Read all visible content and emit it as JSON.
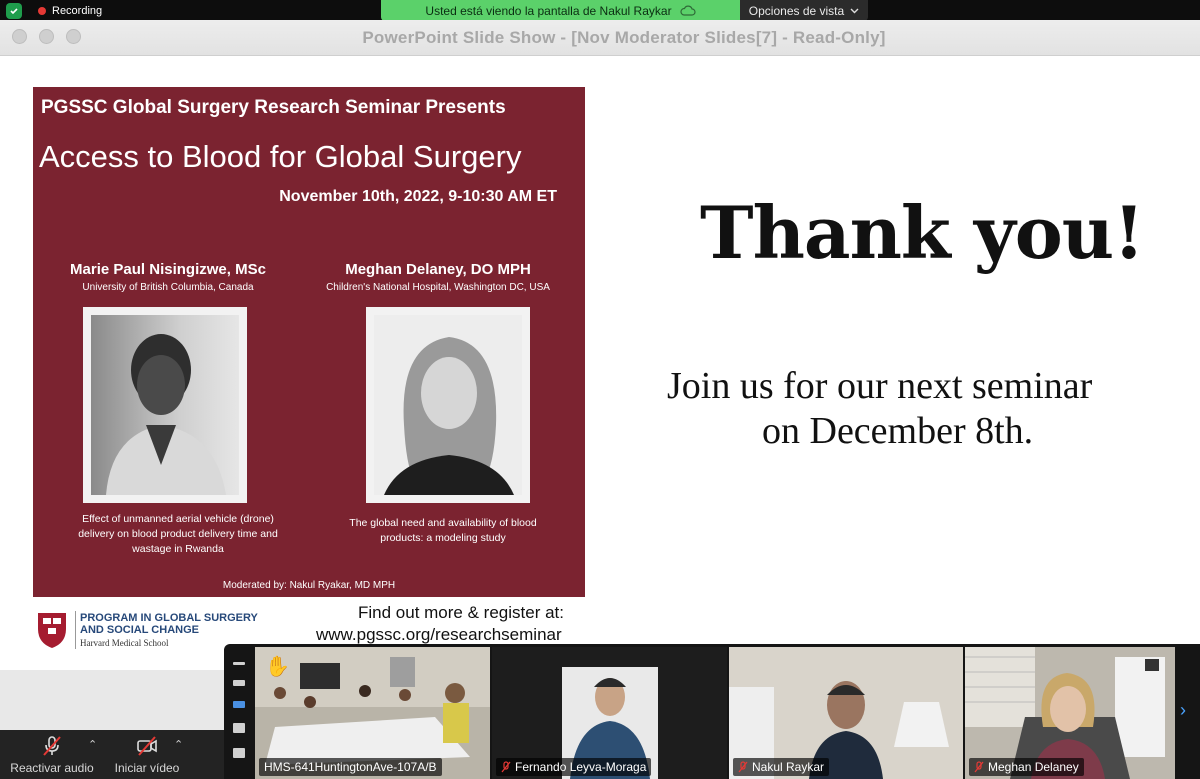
{
  "zoom_top": {
    "recording_label": "Recording",
    "sharing_banner": "Usted está viendo la pantalla de Nakul Raykar",
    "view_options_label": "Opciones de vista"
  },
  "ppt": {
    "window_title": "PowerPoint Slide Show - [Nov Moderator Slides[7]  -  Read-Only]"
  },
  "slide": {
    "flyer": {
      "heading": "PGSSC Global Surgery Research Seminar Presents",
      "title": "Access to Blood for Global Surgery",
      "date": "November 10th, 2022, 9-10:30 AM ET",
      "speakers": [
        {
          "name": "Marie Paul Nisingizwe, MSc",
          "affiliation": "University of British Columbia, Canada",
          "talk_lines": [
            "Effect of unmanned aerial vehicle (drone)",
            "delivery on blood product delivery time and",
            "wastage in Rwanda"
          ]
        },
        {
          "name": "Meghan Delaney, DO MPH",
          "affiliation": "Children's National Hospital, Washington DC, USA",
          "talk_lines": [
            "The global need and availability of blood",
            "products: a modeling study"
          ]
        }
      ],
      "moderated_by": "Moderated by: Nakul Ryakar, MD MPH"
    },
    "program": {
      "line1": "PROGRAM IN GLOBAL SURGERY",
      "line2": "AND SOCIAL CHANGE",
      "school": "Harvard Medical School"
    },
    "find_out": "Find out more & register at:",
    "url": "www.pgssc.org/researchseminar",
    "thank_you": "Thank you!",
    "join_line1": "Join us for our next seminar",
    "join_line2": "on December 8th."
  },
  "controls": {
    "audio_label": "Reactivar audio",
    "video_label": "Iniciar vídeo"
  },
  "participants": [
    {
      "name": "HMS-641HuntingtonAve-107A/B",
      "muted": false
    },
    {
      "name": "Fernando Leyva-Moraga",
      "muted": true
    },
    {
      "name": "Nakul Raykar",
      "muted": true
    },
    {
      "name": "Meghan Delaney",
      "muted": true
    }
  ],
  "colors": {
    "flyer_bg": "#7b2330",
    "share_banner": "#5bd16a",
    "mute_red": "#e53935"
  }
}
